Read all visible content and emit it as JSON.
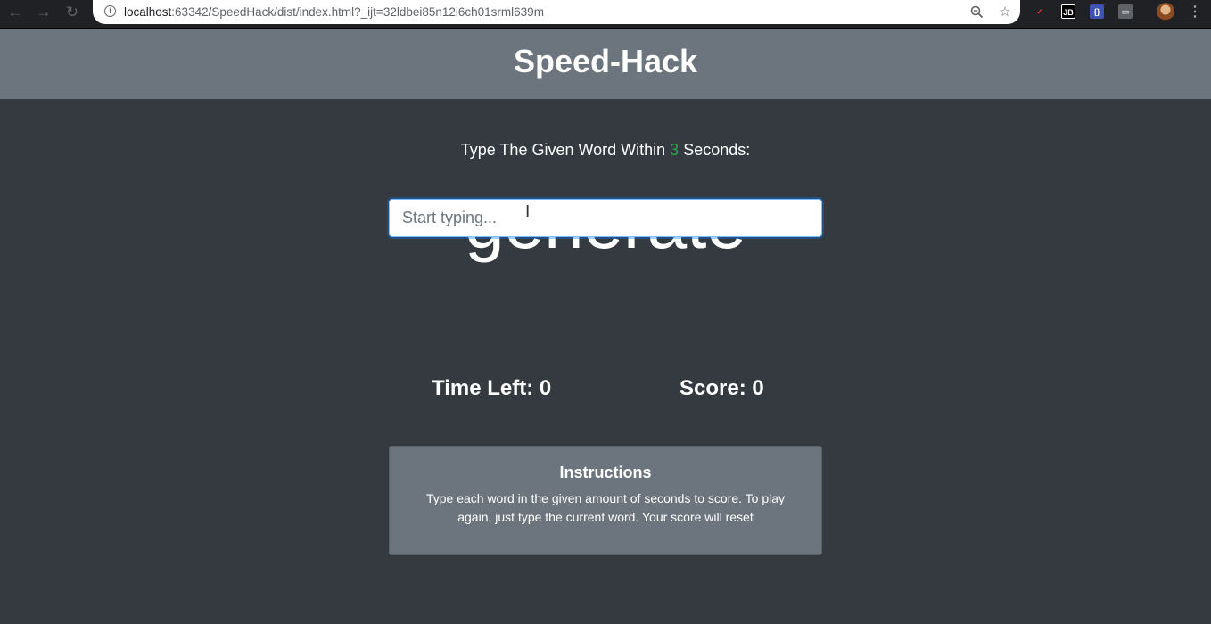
{
  "browser": {
    "url_host": "localhost",
    "url_rest": ":63342/SpeedHack/dist/index.html?_ijt=32ldbei85n12i6ch01srml639m",
    "icons": {
      "back": "back-arrow-icon",
      "forward": "forward-arrow-icon",
      "reload": "reload-icon",
      "info": "info-icon",
      "zoom": "zoom-icon",
      "star": "star-icon",
      "menu": "kebab-menu-icon"
    },
    "extensions": [
      {
        "label": "✓"
      },
      {
        "label": "JB"
      },
      {
        "label": "{}"
      },
      {
        "label": "▭"
      }
    ]
  },
  "header": {
    "title": "Speed-Hack"
  },
  "main": {
    "lead_prefix": "Type The Given Word Within ",
    "lead_seconds": "3",
    "lead_suffix": " Seconds:",
    "current_word": "generate",
    "input_placeholder": "Start typing...",
    "time_left_label": "Time Left: 0",
    "score_label": "Score: 0"
  },
  "instructions": {
    "title": "Instructions",
    "body": "Type each word in the given amount of seconds to score. To play again, just type the current word. Your score will reset"
  },
  "colors": {
    "page_bg": "#343a40",
    "header_bg": "#6c757d",
    "seconds_accent": "#28a745",
    "focus_ring": "#80bdff"
  }
}
